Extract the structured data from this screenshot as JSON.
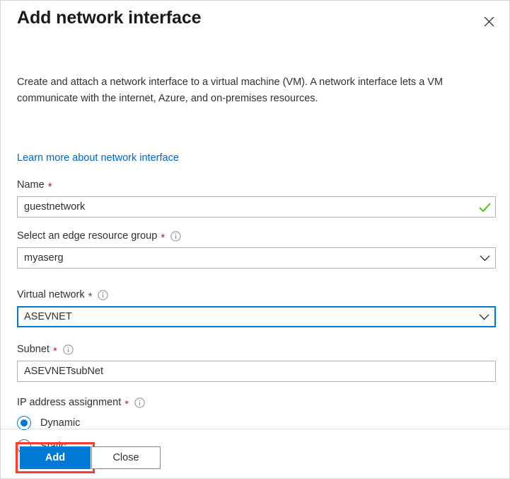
{
  "dialog": {
    "title": "Add network interface",
    "close_icon": "close-icon",
    "description": "Create and attach a network interface to a virtual machine (VM). A network interface lets a VM communicate with the internet, Azure, and on-premises resources.",
    "learn_more_link": "Learn more about network interface"
  },
  "fields": {
    "name": {
      "label": "Name",
      "required_marker": "*",
      "value": "guestnetwork",
      "validation_icon": "checkmark-icon",
      "validation_color": "#4cc21f"
    },
    "edge_resource_group": {
      "label": "Select an edge resource group",
      "required_marker": "*",
      "info_icon": "info-icon",
      "value": "myaserg",
      "dropdown_icon": "chevron-down-icon"
    },
    "virtual_network": {
      "label": "Virtual network",
      "required_marker": "*",
      "info_icon": "info-icon",
      "value": "ASEVNET",
      "dropdown_icon": "chevron-down-icon",
      "focus_color": "#0078d4"
    },
    "subnet": {
      "label": "Subnet",
      "required_marker": "*",
      "info_icon": "info-icon",
      "value": "ASEVNETsubNet"
    },
    "ip_address_assignment": {
      "label": "IP address assignment",
      "required_marker": "*",
      "info_icon": "info-icon",
      "selected": "Dynamic",
      "options": [
        {
          "label": "Dynamic",
          "checked": true
        },
        {
          "label": "Static",
          "checked": false
        }
      ]
    }
  },
  "footer": {
    "add_label": "Add",
    "close_label": "Close",
    "primary_color": "#0078d4",
    "highlight_color": "#ff3b30"
  }
}
